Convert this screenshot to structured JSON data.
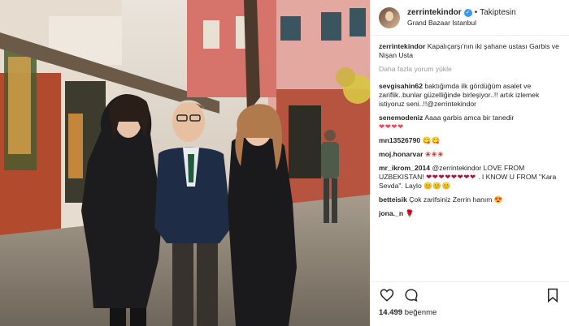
{
  "header": {
    "username": "zerrintekindor",
    "follow_status": "Takiptesin",
    "location": "Grand Bazaar Istanbul"
  },
  "caption": {
    "username": "zerrintekindor",
    "text": "Kapalıçarşı'nın iki şahane ustası Garbis ve Nişan Usta"
  },
  "load_more": "Daha fazla yorum yükle",
  "comments": [
    {
      "username": "sevgisahin62",
      "text": "baktığımda ilk gördüğüm asalet ve zariflik..bunlar güzelliğinde birleşiyor..!! artık izlemek istiyoruz seni..!!@zerrintekindor",
      "emoji": ""
    },
    {
      "username": "senemodeniz",
      "text": "Aaaa garbis amca bir tanedir",
      "emoji": "❤❤❤❤"
    },
    {
      "username": "mn13526790",
      "text": "",
      "emoji": "😋😋"
    },
    {
      "username": "moj.honarvar",
      "text": "",
      "emoji": "❀❀❀"
    },
    {
      "username": "mr_ikrom_2014",
      "text": "@zerrintekindor LOVE FROM UZBEKISTAN!",
      "emoji": "❤❤❤❤❤❤❤❤",
      "text2": ". I KNOW U FROM \"Kara Sevda\". Laylo",
      "emoji2": "😊😊😊"
    },
    {
      "username": "betteisik",
      "text": "Çok zarifsiniz Zerrin hanım",
      "emoji": "😍"
    },
    {
      "username": "jona._n",
      "text": "",
      "emoji": "🌹"
    }
  ],
  "actions": {
    "likes_count": "14.499",
    "likes_label": "beğenme"
  },
  "colors": {
    "verified": "#3897f0",
    "border": "#efefef",
    "muted": "#999999"
  }
}
